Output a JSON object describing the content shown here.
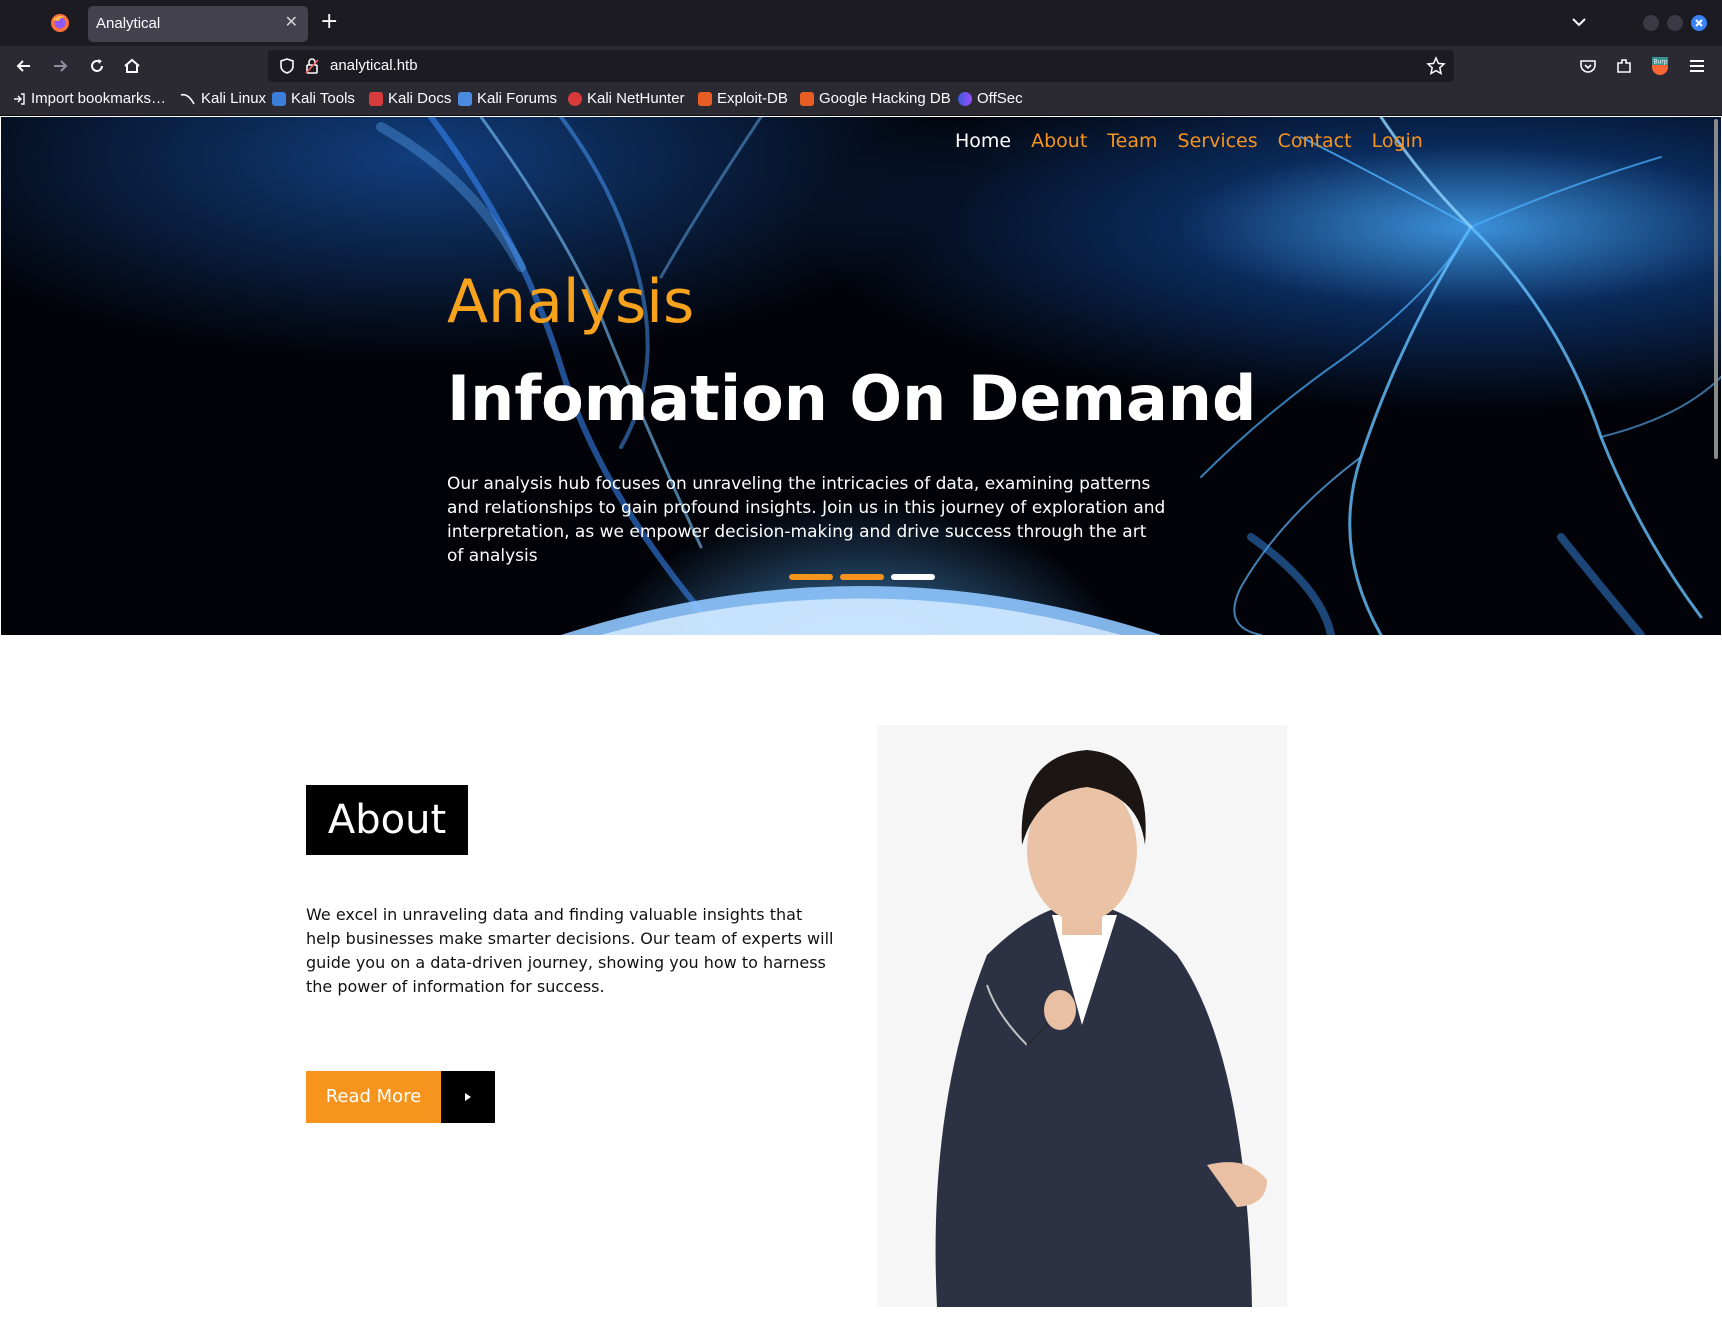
{
  "browser": {
    "tab_title": "Analytical",
    "url": "analytical.htb",
    "bookmarks": [
      "Import bookmarks…",
      "Kali Linux",
      "Kali Tools",
      "Kali Docs",
      "Kali Forums",
      "Kali NetHunter",
      "Exploit-DB",
      "Google Hacking DB",
      "OffSec"
    ],
    "accent": "#3b82f6"
  },
  "site": {
    "nav": [
      "Home",
      "About",
      "Team",
      "Services",
      "Contact",
      "Login"
    ],
    "accent": "#f7941d",
    "hero": {
      "kicker": "Analysis",
      "title": "Infomation On Demand",
      "text": "Our analysis hub focuses on unraveling the intricacies of data, examining patterns and relationships to gain profound insights. Join us in this journey of exploration and interpretation, as we empower decision-making and drive success through the art of analysis",
      "slides": 3,
      "active_slide": 3
    },
    "about": {
      "heading": "About",
      "text": "We excel in unraveling data and finding valuable insights that help businesses make smarter decisions. Our team of experts will guide you on a data-driven journey, showing you how to harness the power of information for success.",
      "button": "Read More"
    }
  }
}
